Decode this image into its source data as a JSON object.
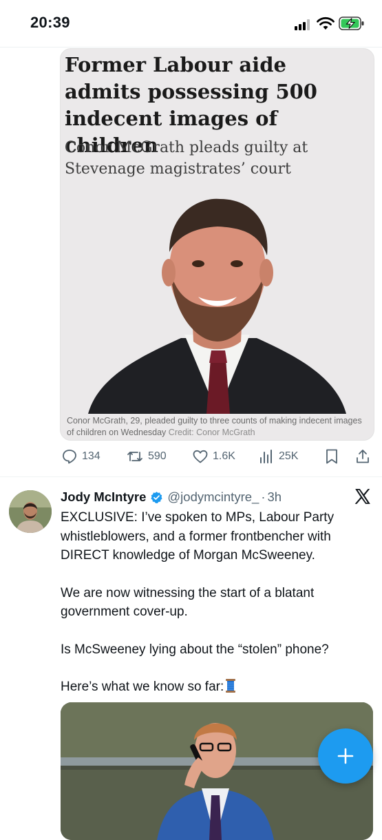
{
  "status_bar": {
    "time": "20:39",
    "icons": [
      "signal-icon",
      "wifi-icon",
      "battery-charging-icon"
    ]
  },
  "news_card": {
    "headline": "Former Labour aide admits possessing 500 indecent images of children",
    "subheadline": "Conor McGrath pleads guilty at Stevenage magistrates’ court",
    "caption": "Conor McGrath, 29, pleaded guilty to three counts of making indecent images of children on Wednesday",
    "credit": "Credit: Conor McGrath"
  },
  "actions": {
    "replies": "134",
    "reposts": "590",
    "likes": "1.6K",
    "views": "25K",
    "icons": [
      "reply-icon",
      "repost-icon",
      "like-icon",
      "views-icon",
      "bookmark-icon",
      "share-icon"
    ]
  },
  "post": {
    "author_name": "Jody McIntyre",
    "handle": "@jodymcintyre_",
    "separator": "·",
    "time": "3h",
    "paragraphs": [
      "EXCLUSIVE: I’ve spoken to MPs, Labour Party whistleblowers, and a former frontbencher with DIRECT knowledge of Morgan McSweeney.",
      "We are now witnessing the start of a blatant government cover-up.",
      "Is McSweeney lying about the “stolen” phone?",
      "Here’s what we know so far:"
    ]
  },
  "colors": {
    "accent": "#1d9bf0",
    "text": "#0f1419",
    "muted": "#536471"
  }
}
